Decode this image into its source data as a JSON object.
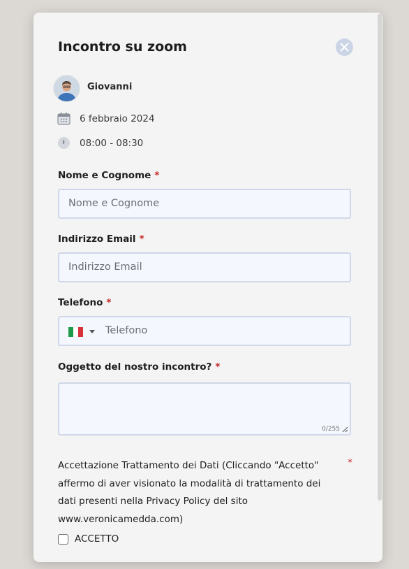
{
  "modal": {
    "title": "Incontro su zoom",
    "host_name": "Giovanni",
    "date": "6 febbraio 2024",
    "time": "08:00 - 08:30"
  },
  "form": {
    "name": {
      "label": "Nome e Cognome",
      "required_mark": "*",
      "placeholder": "Nome e Cognome",
      "value": ""
    },
    "email": {
      "label": "Indirizzo Email",
      "required_mark": "*",
      "placeholder": "Indirizzo Email",
      "value": ""
    },
    "phone": {
      "label": "Telefono",
      "required_mark": "*",
      "placeholder": "Telefono",
      "country": "IT",
      "value": ""
    },
    "subject": {
      "label": "Oggetto del nostro incontro?",
      "required_mark": "*",
      "value": "",
      "counter": "0/255"
    },
    "consent": {
      "text": "Accettazione Trattamento dei Dati (Cliccando \"Accetto\" affermo di aver visionato la modalità di trattamento dei dati presenti nella Privacy Policy del sito www.veronicamedda.com)",
      "required_mark": "*",
      "checkbox_label": "ACCETTO",
      "checked": false
    }
  },
  "colors": {
    "page_bg": "#dcd8d4",
    "modal_bg": "#f4f4f4",
    "input_bg": "#f4f7fd",
    "input_border": "#cfd8ea",
    "required": "#c62828",
    "close_button_bg": "#cbd5e6"
  },
  "icons": {
    "close": "close-icon",
    "date": "calendar-icon",
    "time": "clock-icon",
    "phone_country": "italy-flag-icon",
    "dropdown": "chevron-down-icon"
  }
}
